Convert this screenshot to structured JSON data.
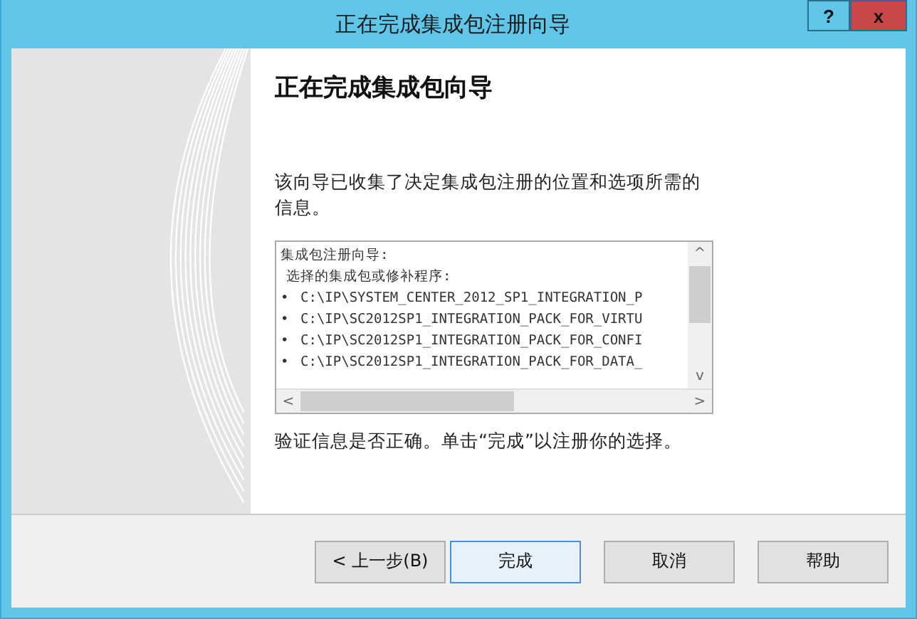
{
  "window": {
    "title": "正在完成集成包注册向导",
    "help_button": "?",
    "close_button": "x"
  },
  "heading": "正在完成集成包向导",
  "intro": "该向导已收集了决定集成包注册的位置和选项所需的信息。",
  "summary": {
    "lines": [
      {
        "kind": "title",
        "text": "集成包注册向导:"
      },
      {
        "kind": "subtitle",
        "text": "选择的集成包或修补程序:"
      },
      {
        "kind": "bullet",
        "bullet": "•",
        "text": "C:\\IP\\SYSTEM_CENTER_2012_SP1_INTEGRATION_P"
      },
      {
        "kind": "bullet",
        "bullet": "•",
        "text": "C:\\IP\\SC2012SP1_INTEGRATION_PACK_FOR_VIRTU"
      },
      {
        "kind": "bullet",
        "bullet": "•",
        "text": "C:\\IP\\SC2012SP1_INTEGRATION_PACK_FOR_CONFI"
      },
      {
        "kind": "bullet",
        "bullet": "•",
        "text": "C:\\IP\\SC2012SP1_INTEGRATION_PACK_FOR_DATA_"
      }
    ],
    "scroll_left": "<",
    "scroll_right": ">",
    "scroll_up": "^",
    "scroll_down": "v"
  },
  "verify": "验证信息是否正确。单击“完成”以注册你的选择。",
  "buttons": [
    {
      "label": "< 上一步(B)",
      "selected": false
    },
    {
      "label": "完成",
      "selected": true
    },
    {
      "label": "取消",
      "selected": false
    },
    {
      "label": "帮助",
      "selected": false
    }
  ]
}
